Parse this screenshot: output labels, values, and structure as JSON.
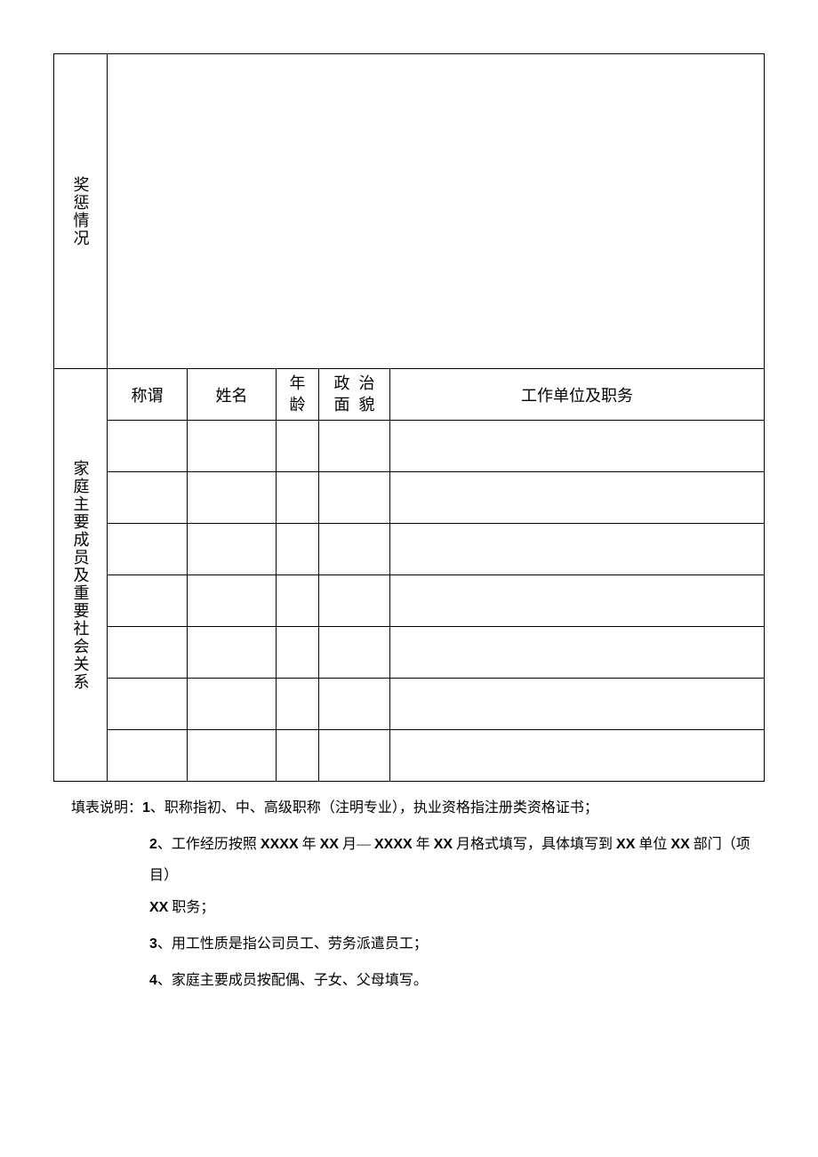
{
  "sections": {
    "rewards_label": "奖惩情况",
    "family_label": "家庭主要成员及重要社会关系"
  },
  "family_header": {
    "relation": "称谓",
    "name": "姓名",
    "age_line1": "年",
    "age_line2": "龄",
    "political_line1": "政治",
    "political_line2": "面貌",
    "workplace": "工作单位及职务"
  },
  "family_rows": [
    {
      "relation": "",
      "name": "",
      "age": "",
      "political": "",
      "workplace": ""
    },
    {
      "relation": "",
      "name": "",
      "age": "",
      "political": "",
      "workplace": ""
    },
    {
      "relation": "",
      "name": "",
      "age": "",
      "political": "",
      "workplace": ""
    },
    {
      "relation": "",
      "name": "",
      "age": "",
      "political": "",
      "workplace": ""
    },
    {
      "relation": "",
      "name": "",
      "age": "",
      "political": "",
      "workplace": ""
    },
    {
      "relation": "",
      "name": "",
      "age": "",
      "political": "",
      "workplace": ""
    },
    {
      "relation": "",
      "name": "",
      "age": "",
      "political": "",
      "workplace": ""
    }
  ],
  "rewards_content": "",
  "notes": {
    "prefix": "填表说明：",
    "item1_num": "1",
    "item1_text": "、职称指初、中、高级职称（注明专业），执业资格指注册类资格证书；",
    "item2_num": "2",
    "item2_a": "、工作经历按照 ",
    "item2_xxxx1": "XXXX",
    "item2_b": " 年 ",
    "item2_xx1": "XX",
    "item2_c": " 月— ",
    "item2_xxxx2": "XXXX",
    "item2_d": " 年 ",
    "item2_xx2": "XX",
    "item2_e": " 月格式填写，具体填写到 ",
    "item2_xx3": "XX",
    "item2_f": " 单位 ",
    "item2_xx4": "XX",
    "item2_g": " 部门（项目）",
    "item2_xx5": "XX",
    "item2_h": " 职务；",
    "item3_num": "3",
    "item3_text": "、用工性质是指公司员工、劳务派遣员工；",
    "item4_num": "4",
    "item4_text": "、家庭主要成员按配偶、子女、父母填写。"
  }
}
